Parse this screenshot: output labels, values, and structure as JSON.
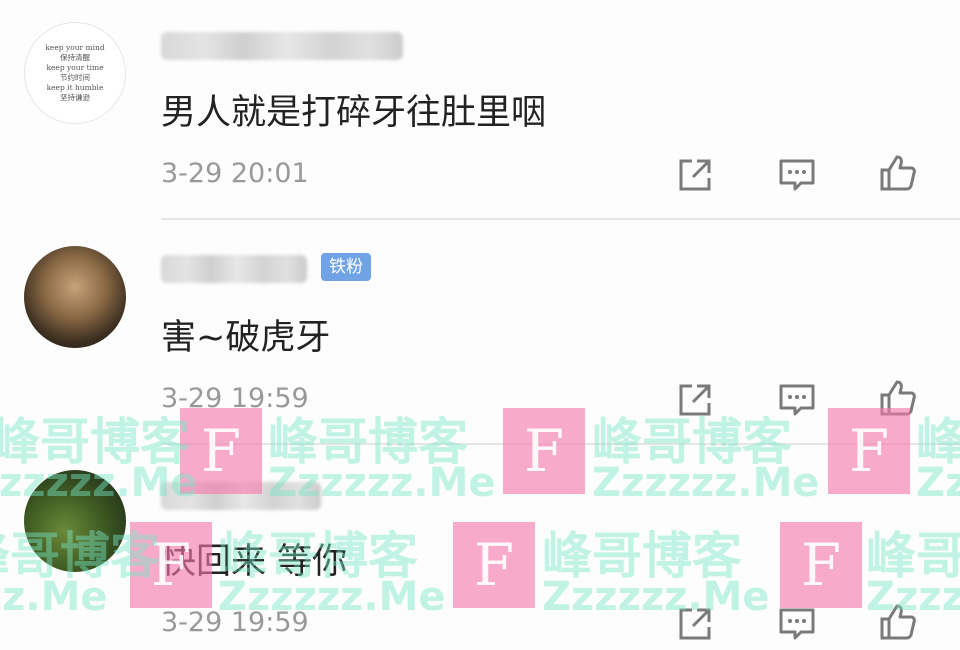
{
  "comments": [
    {
      "avatar_text": [
        "keep your mind",
        "保持清醒",
        "keep your time",
        "节约时间",
        "keep it humble",
        "坚持谦逊"
      ],
      "badge": "",
      "content": "男人就是打碎牙往肚里咽",
      "time": "3-29 20:01"
    },
    {
      "avatar_text": [],
      "badge": "铁粉",
      "content": "害~破虎牙",
      "time": "3-29 19:59"
    },
    {
      "avatar_text": [],
      "badge": "",
      "content": "快回来 等你",
      "time": "3-29 19:59"
    }
  ],
  "actions": [
    "share-icon",
    "reply-icon",
    "like-icon"
  ],
  "watermark": {
    "logo_letter": "F",
    "site_name": "峰哥博客",
    "domain": "Zzzzzz.Me",
    "color_pink": "#f478aa",
    "color_green": "#78e6c8"
  }
}
